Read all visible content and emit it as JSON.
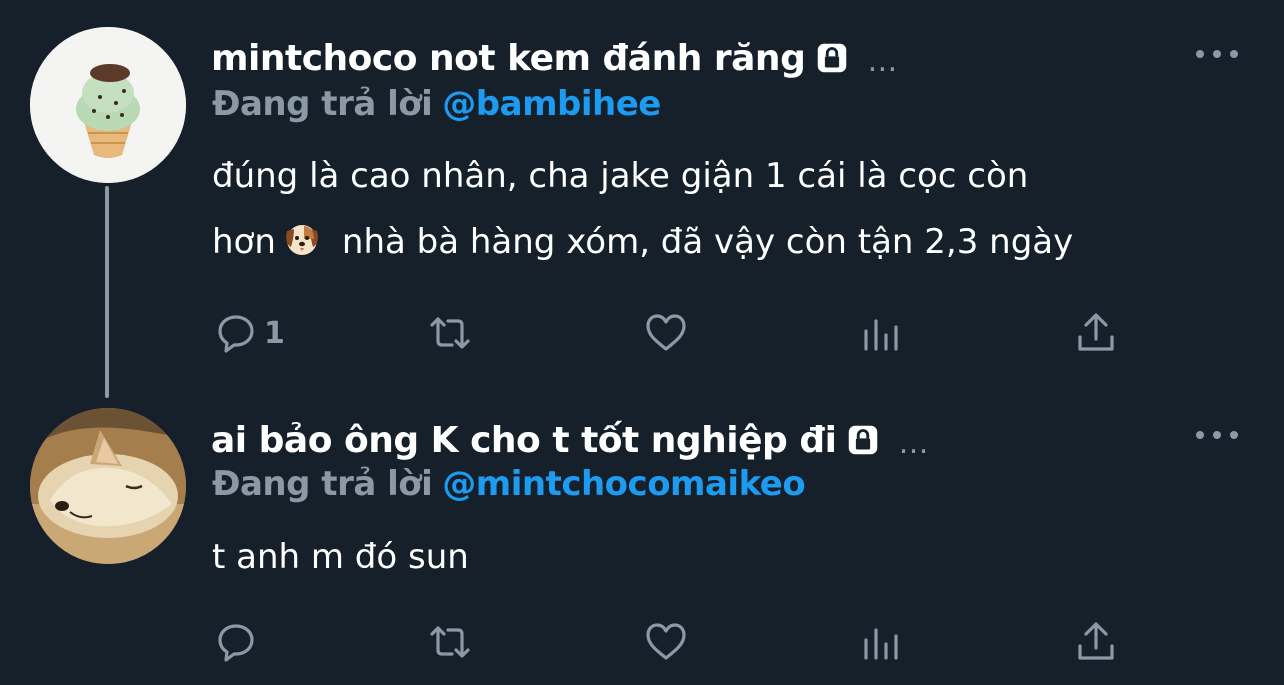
{
  "tweets": [
    {
      "display_name": "mintchoco not kem đánh răng",
      "protected_icon": "lock-icon",
      "reply_label": "Đang trả lời",
      "reply_handle": "@bambihee",
      "text_line1": "đúng là cao nhân, cha jake giận 1 cái là cọc còn",
      "text_line2_before": "hơn",
      "text_emoji": "dog-face-emoji",
      "text_line2_after": "nhà bà hàng xóm, đã vậy còn tận 2,3 ngày",
      "reply_count": "1",
      "avatar": "mint-chocolate-ice-cream-cone"
    },
    {
      "display_name": "ai bảo ông K cho t tốt nghiệp đi",
      "protected_icon": "lock-icon",
      "reply_label": "Đang trả lời",
      "reply_handle": "@mintchocomaikeo",
      "text_line1": "t anh m đó sun",
      "reply_count": "",
      "avatar": "sleeping-dog-photo"
    }
  ],
  "actions": [
    "reply-icon",
    "retweet-icon",
    "like-icon",
    "analytics-icon",
    "share-icon"
  ],
  "colors": {
    "background": "#15202b",
    "text": "#ffffff",
    "secondary": "#8b98a5",
    "link": "#1d9bf0",
    "thread_line": "#8c99a6"
  }
}
